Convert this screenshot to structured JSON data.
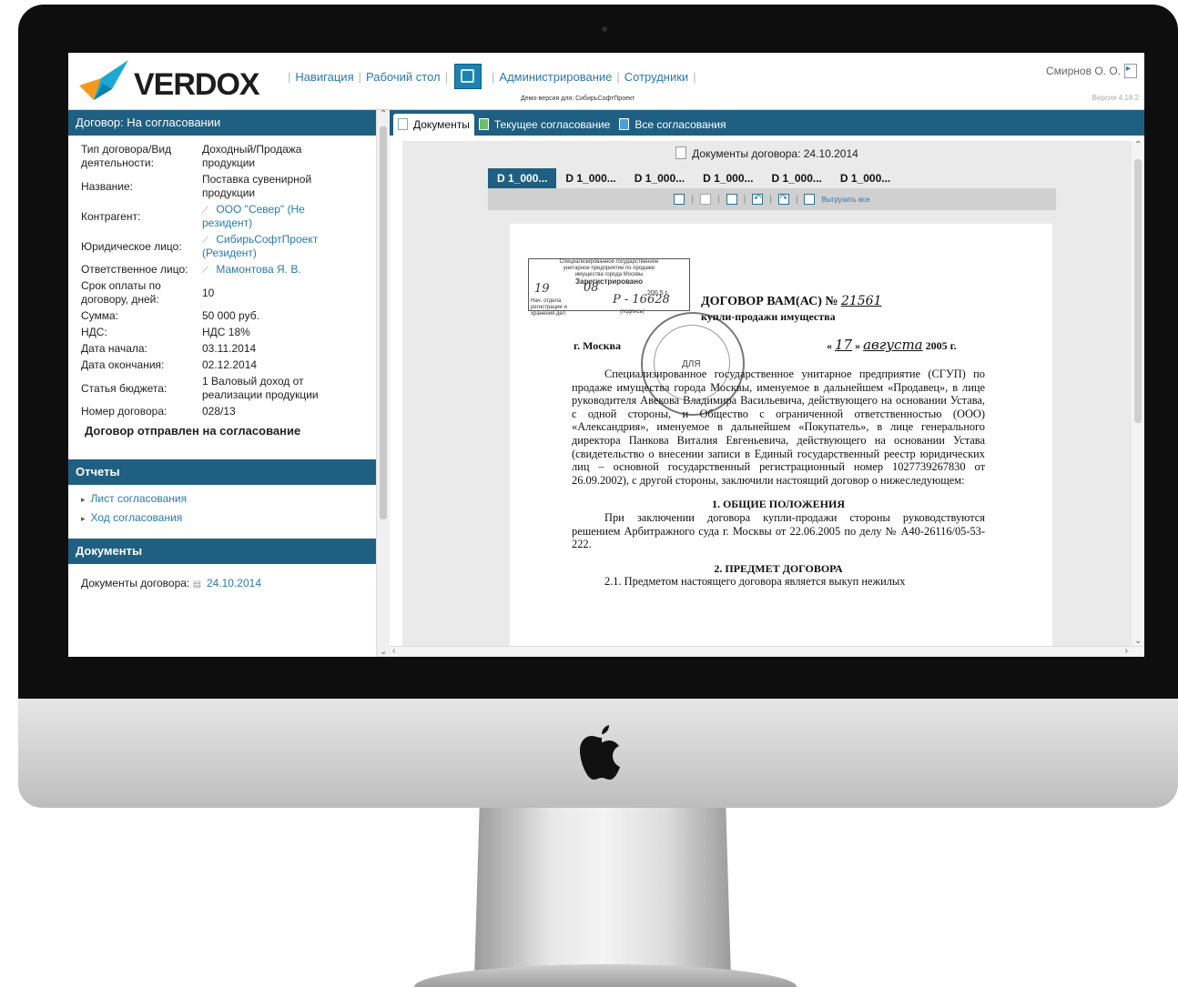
{
  "brand": {
    "logo_text": "VERDOX"
  },
  "topnav": {
    "items": [
      "Навигация",
      "Рабочий стол",
      "Администрирование",
      "Сотрудники"
    ]
  },
  "demo_text": "Демо-версия для: СибирьСофтПроект",
  "user": {
    "name": "Смирнов О. О."
  },
  "version": "Версия 4.18.2",
  "contract": {
    "header": "Договор: На согласовании",
    "fields": [
      {
        "label": "Тип договора/Вид деятельности:",
        "value": "Доходный/Продажа продукции"
      },
      {
        "label": "Название:",
        "value": "Поставка сувенирной продукции"
      },
      {
        "label": "Контрагент:",
        "value": "ООО \"Север\" (Не резидент)"
      },
      {
        "label": "Юридическое лицо:",
        "value": "СибирьСофтПроект (Резидент)"
      },
      {
        "label": "Ответственное лицо:",
        "value": "Мамонтова Я. В."
      },
      {
        "label": "Срок оплаты по договору, дней:",
        "value": "10"
      },
      {
        "label": "Сумма:",
        "value": "50 000 руб."
      },
      {
        "label": "НДС:",
        "value": "НДС 18%"
      },
      {
        "label": "Дата начала:",
        "value": "03.11.2014"
      },
      {
        "label": "Дата окончания:",
        "value": "02.12.2014"
      },
      {
        "label": "Статья бюджета:",
        "value": "1 Валовый доход от реализации продукции"
      },
      {
        "label": "Номер договора:",
        "value": "028/13"
      }
    ],
    "status_message": "Договор отправлен на согласование"
  },
  "reports": {
    "header": "Отчеты",
    "items": [
      "Лист согласования",
      "Ход согласования"
    ]
  },
  "documents": {
    "header": "Документы",
    "label": "Документы договора:",
    "link": "24.10.2014"
  },
  "tabs": [
    "Документы",
    "Текущее согласование",
    "Все согласования"
  ],
  "viewer": {
    "title": "Документы договора: 24.10.2014",
    "doc_tabs": [
      "D 1_000...",
      "D 1_000...",
      "D 1_000...",
      "D 1_000...",
      "D 1_000...",
      "D 1_000..."
    ],
    "download_all": "Выгрузить все"
  },
  "scan": {
    "stamp_lines": [
      "Специализированное государственное",
      "унитарное предприятие по продаже",
      "имущества города Москвы",
      "Зарегистрировано"
    ],
    "stamp_day": "19",
    "stamp_month": "08",
    "stamp_year": "200 5 г.",
    "stamp_reg_label": "Нач. отдела регистрации и хранения дел",
    "stamp_reg_no": "Р - 16628",
    "stamp_sign": "(подпись)",
    "title": "ДОГОВОР ВАМ(АС) №",
    "title_num": "21561",
    "subtitle": "купли-продажи имущества",
    "city": "г. Москва",
    "date_day": "17",
    "date_month": "августа",
    "date_year": "2005 г.",
    "seal_text": "ДЛЯ",
    "para1": "Специализированное государственное унитарное предприятие (СГУП) по продаже имущества города Москвы, именуемое в дальнейшем «Продавец», в лице руководителя Авекова Владимира Васильевича, действующего на основании Устава, с одной стороны, и Общество с ограниченной ответственностью (ООО) «Александрия», именуемое в дальнейшем «Покупатель», в лице генерального директора Панкова Виталия Евгеньевича, действующего на основании Устава (свидетельство о внесении записи в Единый государственный реестр юридических лиц – основной государственный регистрационный номер 1027739267830 от 26.09.2002), с другой стороны, заключили настоящий договор о нижеследующем:",
    "heading1": "1. ОБЩИЕ ПОЛОЖЕНИЯ",
    "para2": "При заключении договора купли-продажи стороны руководствуются решением Арбитражного суда г. Москвы от 22.06.2005 по делу № А40-26116/05-53-222.",
    "heading2": "2. ПРЕДМЕТ ДОГОВОРА",
    "para3": "2.1. Предметом настоящего договора является выкуп нежилых"
  }
}
